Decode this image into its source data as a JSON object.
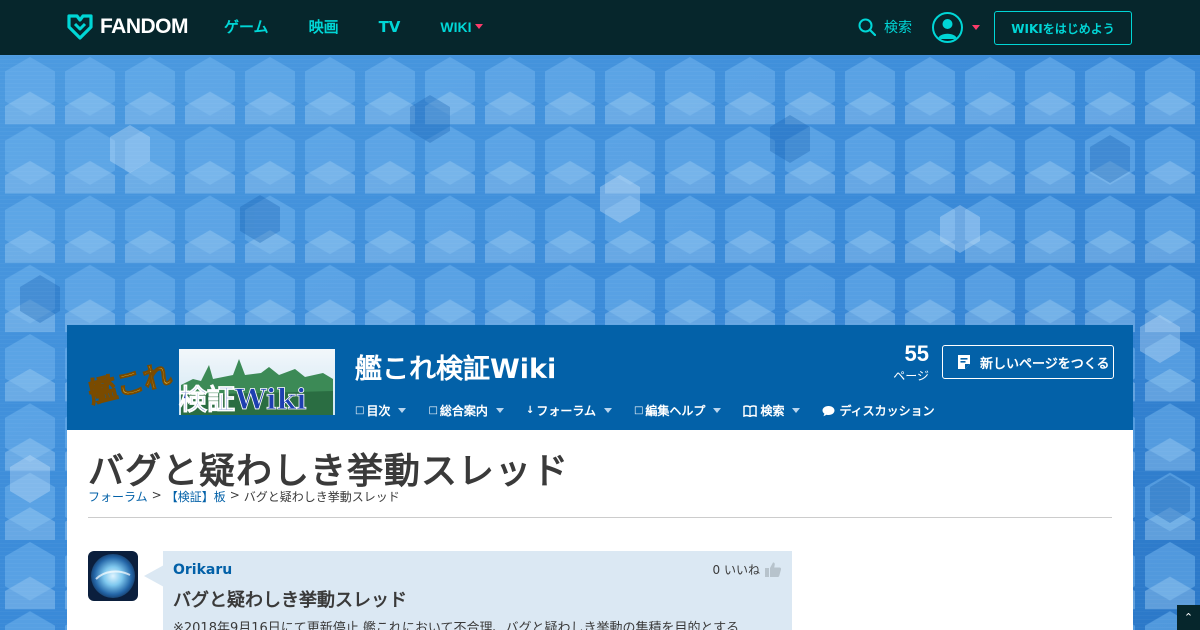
{
  "topbar": {
    "brand": "FANDOM",
    "nav": [
      "ゲーム",
      "映画",
      "TV",
      "WIKI"
    ],
    "search_label": "検索",
    "start_wiki_label": "WIKIをはじめよう"
  },
  "wiki": {
    "logo_text_1": "艦これ",
    "logo_text_2": "検証Wiki",
    "title": "艦これ検証Wiki",
    "page_count": "55",
    "page_count_label": "ページ",
    "new_page_label": "新しいページをつくる",
    "nav": [
      {
        "label": "目次"
      },
      {
        "label": "総合案内"
      },
      {
        "label": "フォーラム"
      },
      {
        "label": "編集ヘルプ"
      },
      {
        "label": "検索"
      },
      {
        "label": "ディスカッション"
      }
    ]
  },
  "article": {
    "title": "バグと疑わしき挙動スレッド",
    "breadcrumb": [
      "フォーラム",
      "【検証】板",
      "バグと疑わしき挙動スレッド"
    ],
    "breadcrumb_sep": ">"
  },
  "post": {
    "author": "Orikaru",
    "likes": "0 いいね",
    "title": "バグと疑わしき挙動スレッド",
    "body": "※2018年9月16日にて更新停止 艦これにおいて不合理、バグと疑わしき挙動の集積を目的とする"
  },
  "colors": {
    "topbar_bg": "#06262c",
    "accent_cyan": "#00d6d6",
    "accent_red": "#fc3b6a",
    "wiki_header_bg": "#0361a8",
    "post_bubble_bg": "#dbe8f3",
    "link": "#0361a8"
  },
  "icons": {
    "brand_logo": "fandom-heart-icon",
    "search": "search-icon",
    "user": "user-avatar-icon",
    "new_page": "new-page-icon",
    "discussion": "speech-bubble-icon",
    "like": "thumbs-up-icon",
    "scroll_top": "chevron-up-icon"
  }
}
